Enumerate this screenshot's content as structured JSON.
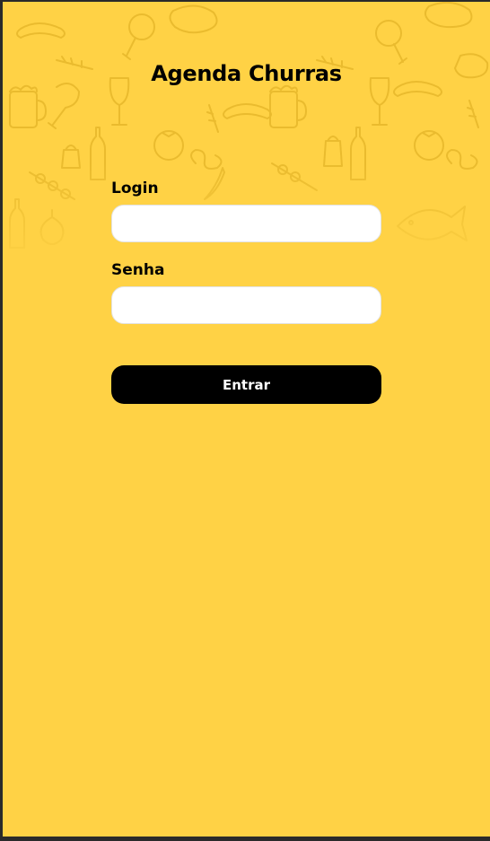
{
  "app": {
    "title": "Agenda Churras"
  },
  "form": {
    "login_label": "Login",
    "login_value": "",
    "login_placeholder": "",
    "senha_label": "Senha",
    "senha_value": "",
    "senha_placeholder": "",
    "submit_label": "Entrar"
  },
  "colors": {
    "background": "#FFD245",
    "button": "#000000",
    "button_text": "#FFFFFF",
    "input_bg": "#FFFFFF"
  },
  "icons": {
    "pattern": [
      "steak-icon",
      "sausage-icon",
      "beer-mug-icon",
      "wine-glass-icon",
      "chicken-leg-icon",
      "bottle-icon",
      "tomato-icon",
      "salt-shaker-icon",
      "herb-icon",
      "pepper-icon",
      "skewer-icon",
      "onion-icon",
      "fish-icon",
      "pretzel-icon"
    ]
  }
}
